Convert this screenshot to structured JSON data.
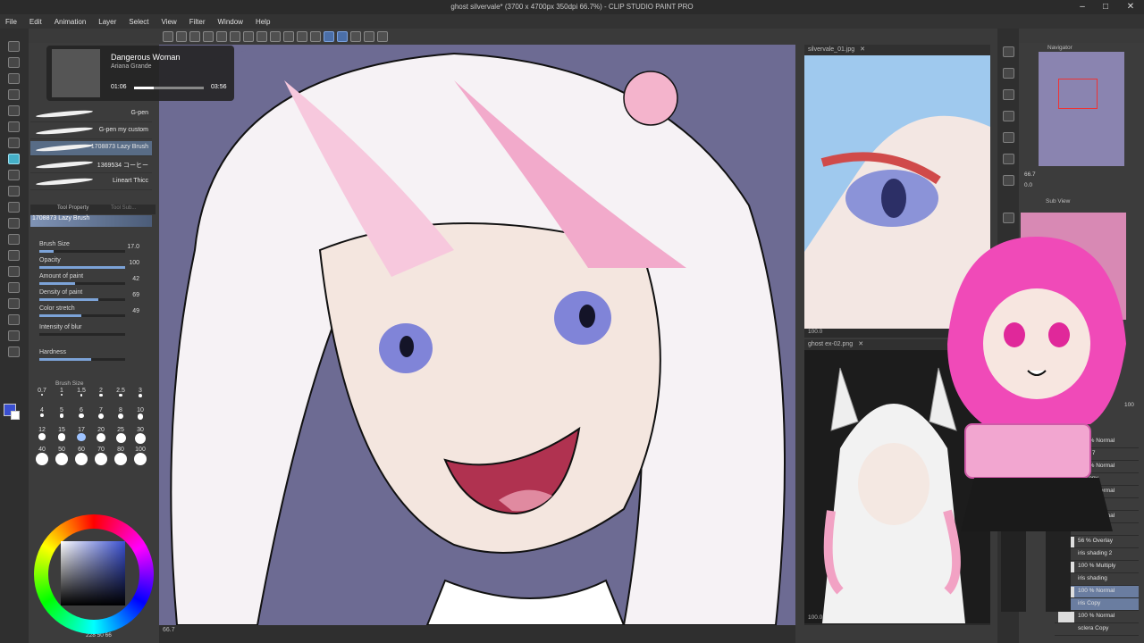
{
  "window": {
    "title": "ghost silvervale* (3700 x 4700px 350dpi 66.7%) - CLIP STUDIO PAINT PRO"
  },
  "menu": [
    "File",
    "Edit",
    "Animation",
    "Layer",
    "Select",
    "View",
    "Filter",
    "Window",
    "Help"
  ],
  "music": {
    "song": "Dangerous Woman",
    "artist": "Ariana Grande",
    "elapsed": "01:06",
    "total": "03:56",
    "progress": 0.28
  },
  "brushes": [
    {
      "name": "G-pen",
      "selected": false
    },
    {
      "name": "G-pen my custom",
      "selected": false
    },
    {
      "name": "1708873 Lazy Brush",
      "selected": true
    },
    {
      "name": "1369534 コーヒー",
      "selected": false
    },
    {
      "name": "Lineart Thicc",
      "selected": false
    }
  ],
  "tool_property": {
    "tab1": "Tool Property",
    "tab2": "Tool Sub...",
    "brush": "1708873 Lazy Brush",
    "props": [
      {
        "label": "Brush Size",
        "value": "17.0",
        "fill": 0.17
      },
      {
        "label": "Opacity",
        "value": "100",
        "fill": 1.0
      },
      {
        "label": "Amount of paint",
        "value": "42",
        "fill": 0.42
      },
      {
        "label": "Density of paint",
        "value": "69",
        "fill": 0.69
      },
      {
        "label": "Color stretch",
        "value": "49",
        "fill": 0.49
      },
      {
        "label": "Intensity of blur",
        "value": "",
        "fill": 0.0
      },
      {
        "label": "Hardness",
        "value": "",
        "fill": 0.6
      }
    ]
  },
  "brush_size": {
    "title": "Brush Size",
    "values": [
      "0.7",
      "1",
      "1.5",
      "2",
      "2.5",
      "3",
      "4",
      "5",
      "6",
      "7",
      "8",
      "10",
      "12",
      "15",
      "17",
      "20",
      "25",
      "30",
      "40",
      "50",
      "60",
      "70",
      "80",
      "100"
    ],
    "selected": "17"
  },
  "color": {
    "main": "#3a4fd0",
    "sub": "#ffffff",
    "status": "228 50 66"
  },
  "canvas": {
    "zoom": "66.7"
  },
  "refs": [
    {
      "tab": "silvervale_01.jpg",
      "zoom": "100.0"
    },
    {
      "tab": "ghost ex-02.png",
      "zoom": "100.0"
    }
  ],
  "navigator": {
    "title": "Navigator",
    "zoom": "66.7",
    "angle": "0.0"
  },
  "subview": {
    "title": "Sub View"
  },
  "layers": [
    {
      "blend": "100 % Normal",
      "name": "layer 7"
    },
    {
      "blend": "100 % Normal",
      "name": "er Copy"
    },
    {
      "blend": "100 % Normal",
      "name": "ayer 8"
    },
    {
      "blend": "100 % Normal",
      "name": "pupil 1"
    },
    {
      "blend": "56 % Overlay",
      "name": "iris shading 2"
    },
    {
      "blend": "100 % Multiply",
      "name": "iris shading"
    },
    {
      "blend": "100 % Normal",
      "name": "iris Copy",
      "selected": true
    },
    {
      "blend": "100 % Normal",
      "name": "sclera Copy"
    }
  ],
  "layer_opacity": "100"
}
